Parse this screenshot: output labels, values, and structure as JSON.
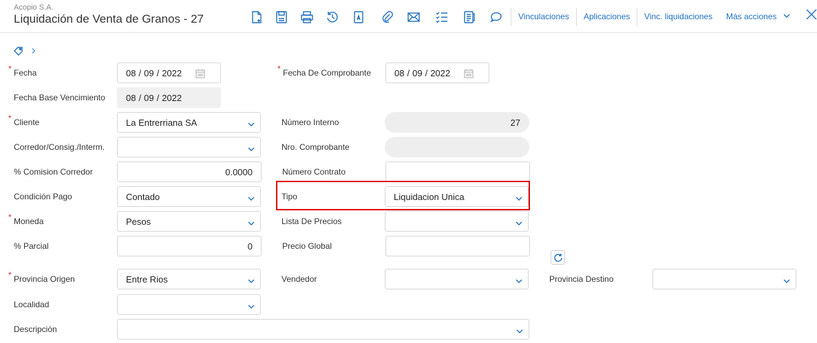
{
  "header": {
    "company": "Acopio S.A.",
    "title": "Liquidación de Venta de Granos - 27",
    "links": {
      "vinculaciones": "Vinculaciones",
      "aplicaciones": "Aplicaciones",
      "vinc_liquidaciones": "Vinc. liquidaciones",
      "mas_acciones": "Más acciones"
    },
    "icons": [
      "new-document-icon",
      "save-icon",
      "print-icon",
      "history-icon",
      "text-document-icon",
      "attachment-icon",
      "email-icon",
      "checklist-icon",
      "notes-icon",
      "comment-icon",
      "chevron-down-icon",
      "close-icon"
    ]
  },
  "form": {
    "fecha": {
      "label": "Fecha",
      "day": "08",
      "month": "09",
      "year": "2022",
      "sep": "/"
    },
    "fecha_comprobante": {
      "label": "Fecha De Comprobante",
      "day": "08",
      "month": "09",
      "year": "2022",
      "sep": "/"
    },
    "fecha_base_venc": {
      "label": "Fecha Base Vencimiento",
      "day": "08",
      "month": "09",
      "year": "2022",
      "sep": "/"
    },
    "cliente": {
      "label": "Cliente",
      "value": "La Entrerriana SA"
    },
    "numero_interno": {
      "label": "Número Interno",
      "value": "27"
    },
    "corredor": {
      "label": "Corredor/Consig./Interm.",
      "value": ""
    },
    "nro_comprobante": {
      "label": "Nro. Comprobante",
      "value": ""
    },
    "comision_corredor": {
      "label": "% Comision Corredor",
      "value": "0.0000"
    },
    "numero_contrato": {
      "label": "Número Contrato",
      "value": ""
    },
    "condicion_pago": {
      "label": "Condición Pago",
      "value": "Contado"
    },
    "tipo": {
      "label": "Tipo",
      "value": "Liquidacion Unica"
    },
    "moneda": {
      "label": "Moneda",
      "value": "Pesos"
    },
    "lista_precios": {
      "label": "Lista De Precios",
      "value": ""
    },
    "parcial": {
      "label": "% Parcial",
      "value": "0"
    },
    "precio_global": {
      "label": "Precio Global",
      "value": ""
    },
    "provincia_origen": {
      "label": "Provincia Origen",
      "value": "Entre Rios"
    },
    "vendedor": {
      "label": "Vendedor",
      "value": ""
    },
    "provincia_destino": {
      "label": "Provincia Destino",
      "value": ""
    },
    "localidad": {
      "label": "Localidad",
      "value": ""
    },
    "descripcion": {
      "label": "Descripción",
      "value": ""
    },
    "required_mark": "*"
  },
  "colors": {
    "accent": "#1f6fbf",
    "required": "#d32f2f",
    "highlight": "#e00000"
  }
}
